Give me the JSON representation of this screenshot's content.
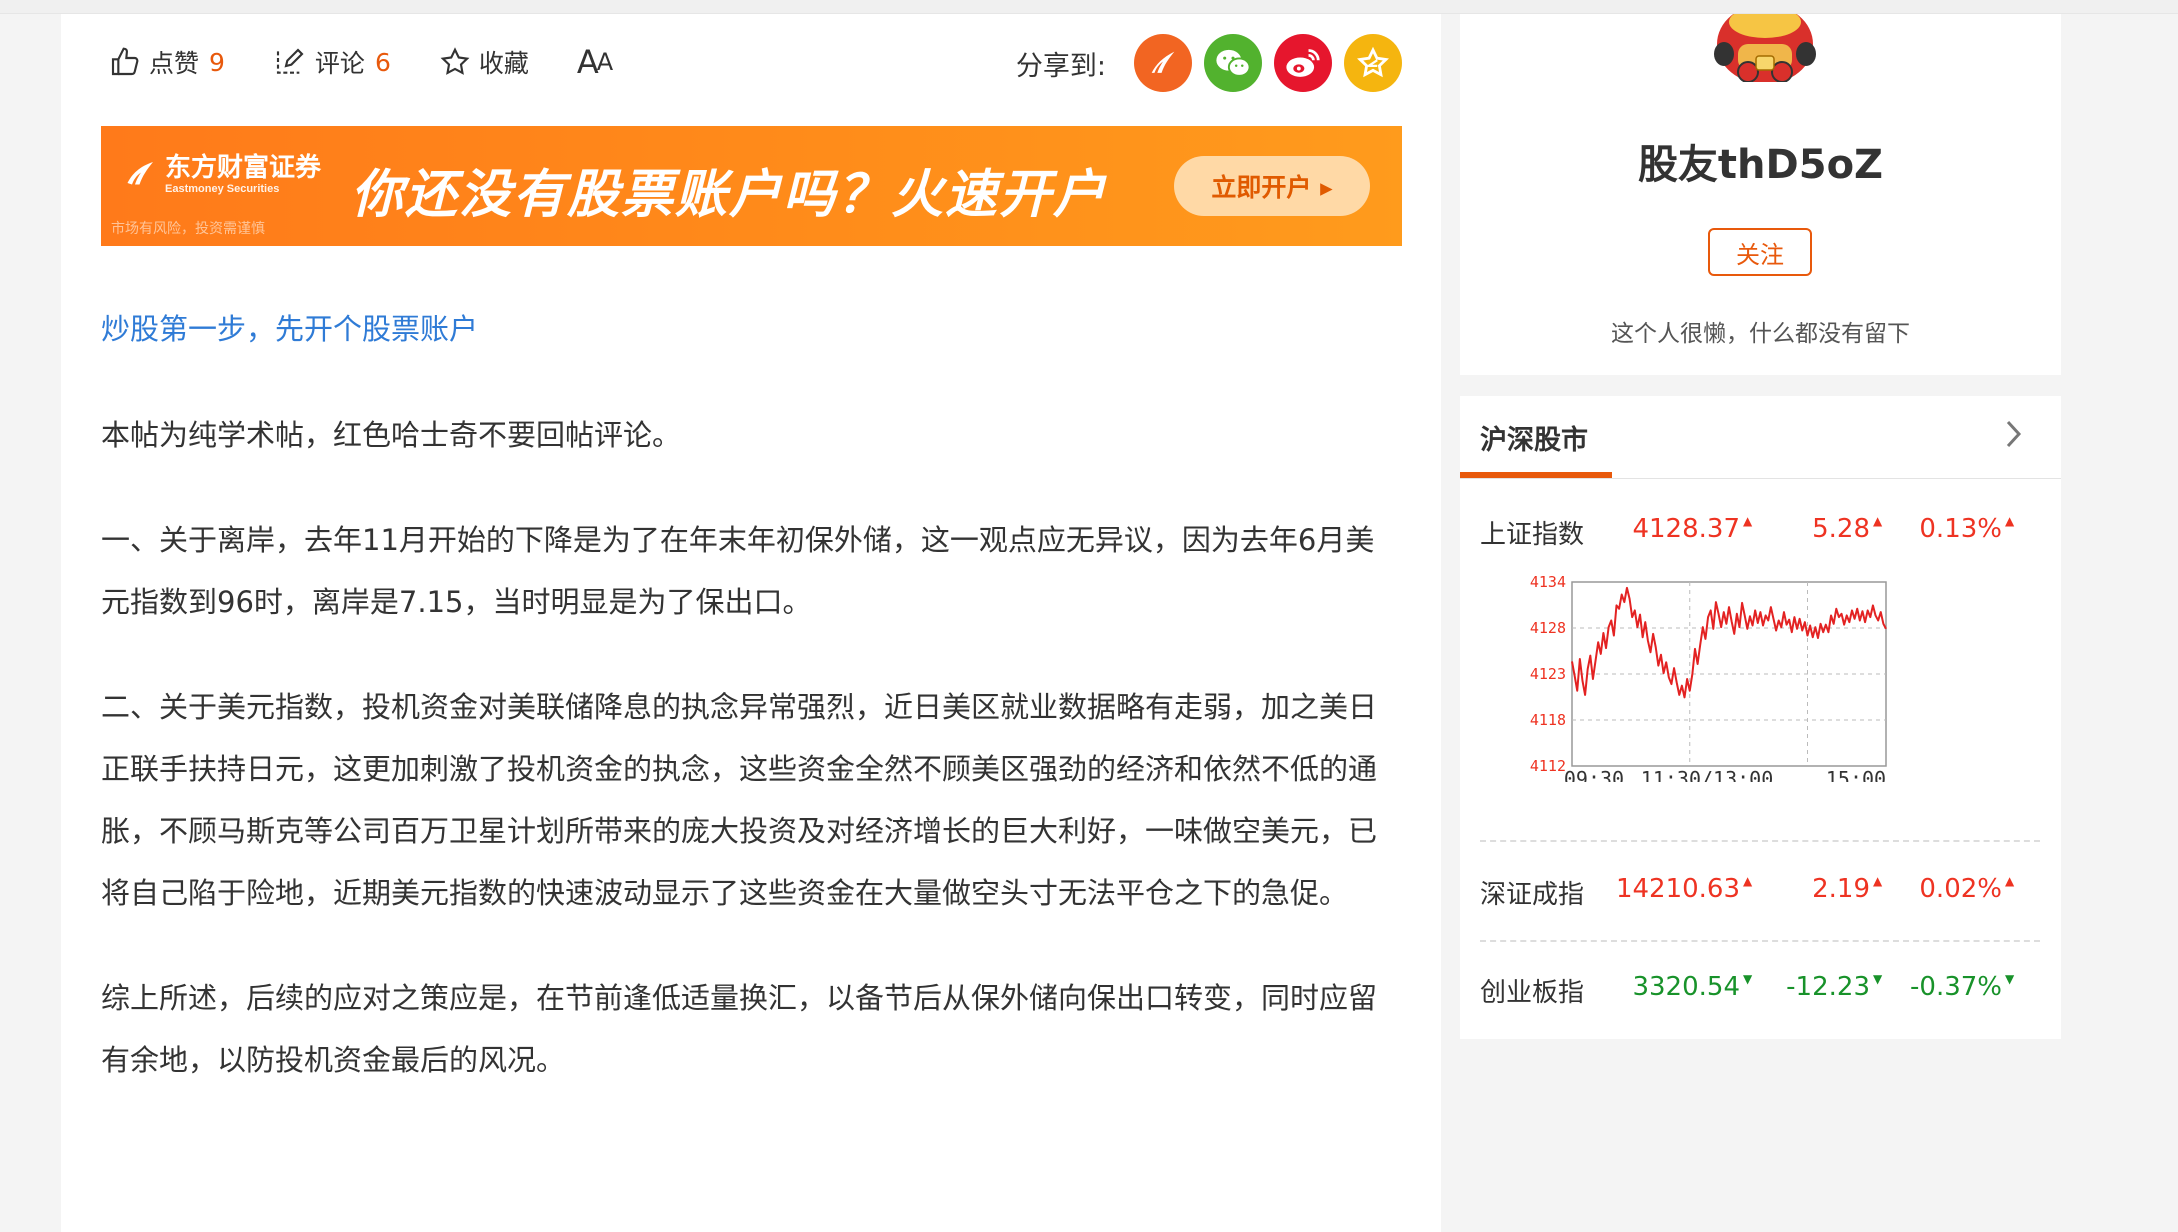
{
  "actions": {
    "like_label": "点赞",
    "like_count": "9",
    "comment_label": "评论",
    "comment_count": "6",
    "favorite_label": "收藏",
    "font_size_label": "A",
    "font_size_label_small": "A",
    "share_label": "分享到:"
  },
  "banner": {
    "brand": "东方财富证券",
    "brand_en": "Eastmoney Securities",
    "risk_note": "市场有风险，投资需谨慎",
    "slogan": "你还没有股票账户吗？火速开户",
    "cta": "立即开户 ▸"
  },
  "article": {
    "promo_link": "炒股第一步，先开个股票账户",
    "paragraphs": [
      "本帖为纯学术帖，红色哈士奇不要回帖评论。",
      "一、关于离岸，去年11月开始的下降是为了在年末年初保外储，这一观点应无异议，因为去年6月美元指数到96时，离岸是7.15，当时明显是为了保出口。",
      "二、关于美元指数，投机资金对美联储降息的执念异常强烈，近日美区就业数据略有走弱，加之美日正联手扶持日元，这更加刺激了投机资金的执念，这些资金全然不顾美区强劲的经济和依然不低的通胀，不顾马斯克等公司百万卫星计划所带来的庞大投资及对经济增长的巨大利好，一味做空美元，已将自己陷于险地，近期美元指数的快速波动显示了这些资金在大量做空头寸无法平仓之下的急促。",
      "综上所述，后续的应对之策应是，在节前逢低适量换汇，以备节后从保外储向保出口转变，同时应留有余地，以防投机资金最后的风况。"
    ]
  },
  "profile": {
    "username": "股友thD5oZ",
    "follow_label": "关注",
    "bio": "这个人很懒，什么都没有留下"
  },
  "market": {
    "title": "沪深股市",
    "indices": [
      {
        "name": "上证指数",
        "price": "4128.37",
        "change": "5.28",
        "pct": "0.13%",
        "dir": "up"
      },
      {
        "name": "深证成指",
        "price": "14210.63",
        "change": "2.19",
        "pct": "0.02%",
        "dir": "up"
      },
      {
        "name": "创业板指",
        "price": "3320.54",
        "change": "-12.23",
        "pct": "-0.37%",
        "dir": "down"
      }
    ]
  },
  "chart_data": {
    "type": "line",
    "title": "",
    "xlabel": "",
    "ylabel": "",
    "y_ticks": [
      "4134",
      "4128",
      "4123",
      "4118",
      "4112"
    ],
    "x_ticks": [
      "09:30",
      "11:30/13:00",
      "15:00"
    ],
    "ylim": [
      4112,
      4134
    ],
    "color": "#e32222",
    "x": [
      0,
      2,
      4,
      6,
      8,
      10,
      12,
      14,
      16,
      18,
      20,
      22,
      24,
      26,
      28,
      30,
      32,
      34,
      36,
      38,
      40,
      42,
      44,
      46,
      48,
      50,
      52,
      54,
      56,
      58,
      60,
      62,
      64,
      66,
      68,
      70,
      72,
      74,
      76,
      78,
      80,
      82,
      84,
      86,
      88,
      90,
      92,
      94,
      96,
      98,
      100,
      102,
      104,
      106,
      108,
      110,
      112,
      114,
      116,
      118,
      120,
      122,
      124,
      126,
      128,
      130,
      132,
      134,
      136,
      138,
      140,
      142,
      144,
      146,
      148,
      150,
      152,
      154,
      156,
      158,
      160,
      162,
      164,
      166,
      168,
      170,
      172,
      174,
      176,
      178,
      180,
      182,
      184,
      186,
      188,
      190,
      192,
      194,
      196,
      198,
      200,
      202,
      204,
      206,
      208,
      210,
      212,
      214,
      216,
      218,
      220,
      222,
      224,
      226,
      228,
      230,
      232,
      234,
      236,
      238,
      240
    ],
    "values": [
      4124.5,
      4122.8,
      4121.0,
      4124.8,
      4122.2,
      4120.5,
      4123.6,
      4125.2,
      4122.4,
      4124.6,
      4126.8,
      4125.4,
      4127.9,
      4126.1,
      4128.6,
      4129.4,
      4127.6,
      4131.2,
      4130.8,
      4132.5,
      4131.6,
      4133.3,
      4132.0,
      4129.8,
      4130.6,
      4128.6,
      4130.1,
      4127.4,
      4129.2,
      4127.0,
      4125.6,
      4127.8,
      4126.2,
      4124.0,
      4125.3,
      4123.1,
      4124.4,
      4122.6,
      4121.8,
      4123.7,
      4122.0,
      4120.5,
      4121.6,
      4120.2,
      4122.4,
      4121.0,
      4123.0,
      4126.0,
      4124.2,
      4126.5,
      4128.6,
      4127.2,
      4129.8,
      4130.6,
      4128.4,
      4131.6,
      4130.2,
      4128.6,
      4130.4,
      4129.0,
      4131.0,
      4129.3,
      4127.8,
      4130.2,
      4128.6,
      4131.5,
      4130.0,
      4128.4,
      4129.9,
      4128.8,
      4130.6,
      4129.1,
      4130.4,
      4128.8,
      4130.0,
      4129.4,
      4131.0,
      4129.6,
      4128.2,
      4129.4,
      4128.6,
      4130.4,
      4128.9,
      4129.5,
      4128.0,
      4129.8,
      4128.4,
      4129.6,
      4128.2,
      4129.2,
      4127.6,
      4128.8,
      4127.4,
      4128.6,
      4127.3,
      4129.0,
      4128.0,
      4128.9,
      4128.0,
      4130.0,
      4129.0,
      4130.8,
      4129.8,
      4130.2,
      4128.9,
      4130.0,
      4129.2,
      4130.6,
      4129.6,
      4130.8,
      4129.4,
      4130.5,
      4129.2,
      4130.6,
      4129.8,
      4131.2,
      4130.0,
      4129.4,
      4130.4,
      4129.0,
      4128.4
    ]
  }
}
